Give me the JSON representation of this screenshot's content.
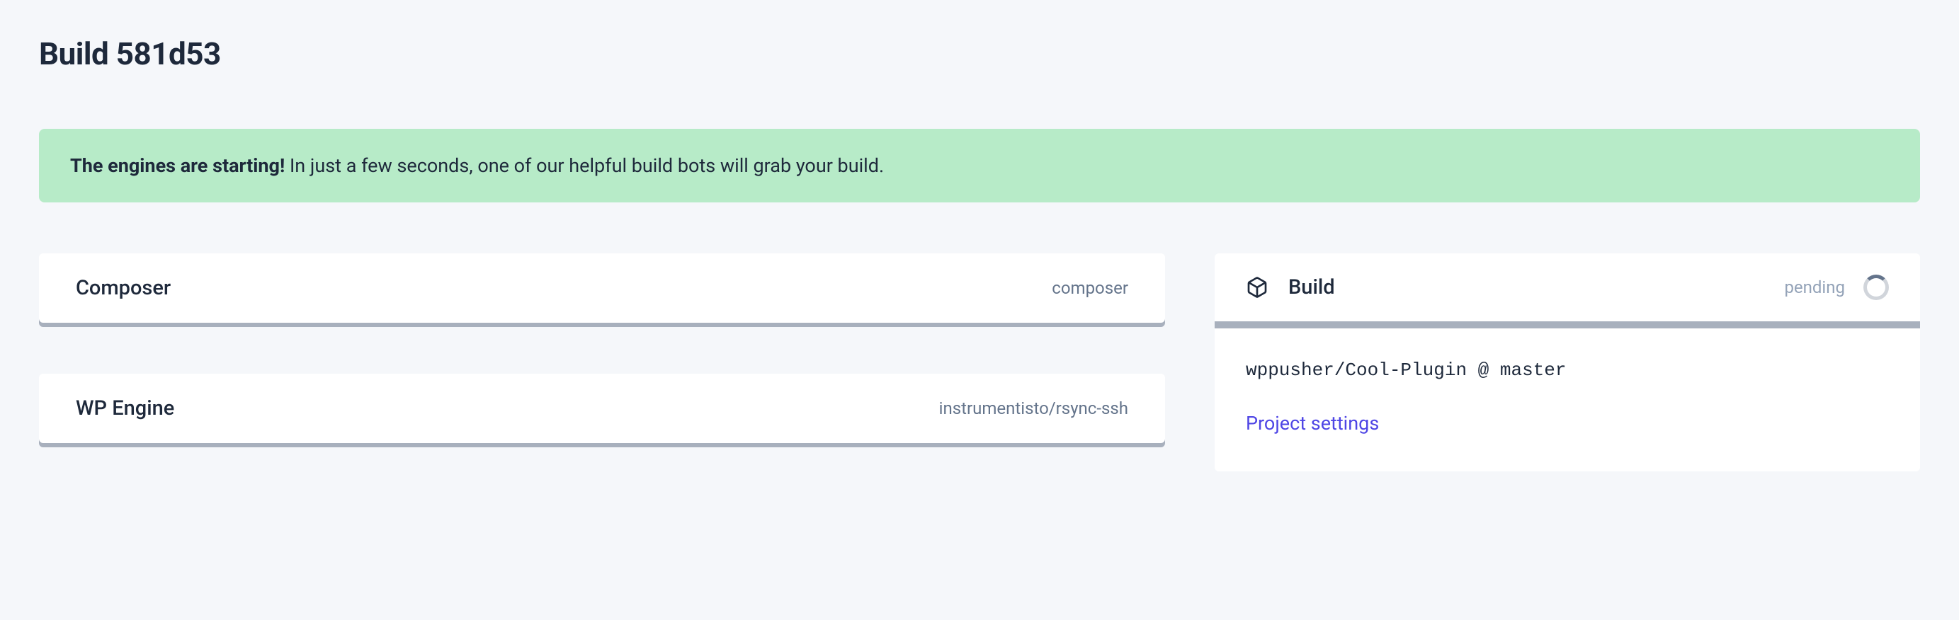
{
  "title": "Build 581d53",
  "alert": {
    "bold": "The engines are starting!",
    "rest": " In just a few seconds, one of our helpful build bots will grab your build."
  },
  "steps": [
    {
      "name": "Composer",
      "meta": "composer"
    },
    {
      "name": "WP Engine",
      "meta": "instrumentisto/rsync-ssh"
    }
  ],
  "build": {
    "title": "Build",
    "status": "pending",
    "repo": "wppusher/Cool-Plugin @ master",
    "settings_label": "Project settings"
  }
}
